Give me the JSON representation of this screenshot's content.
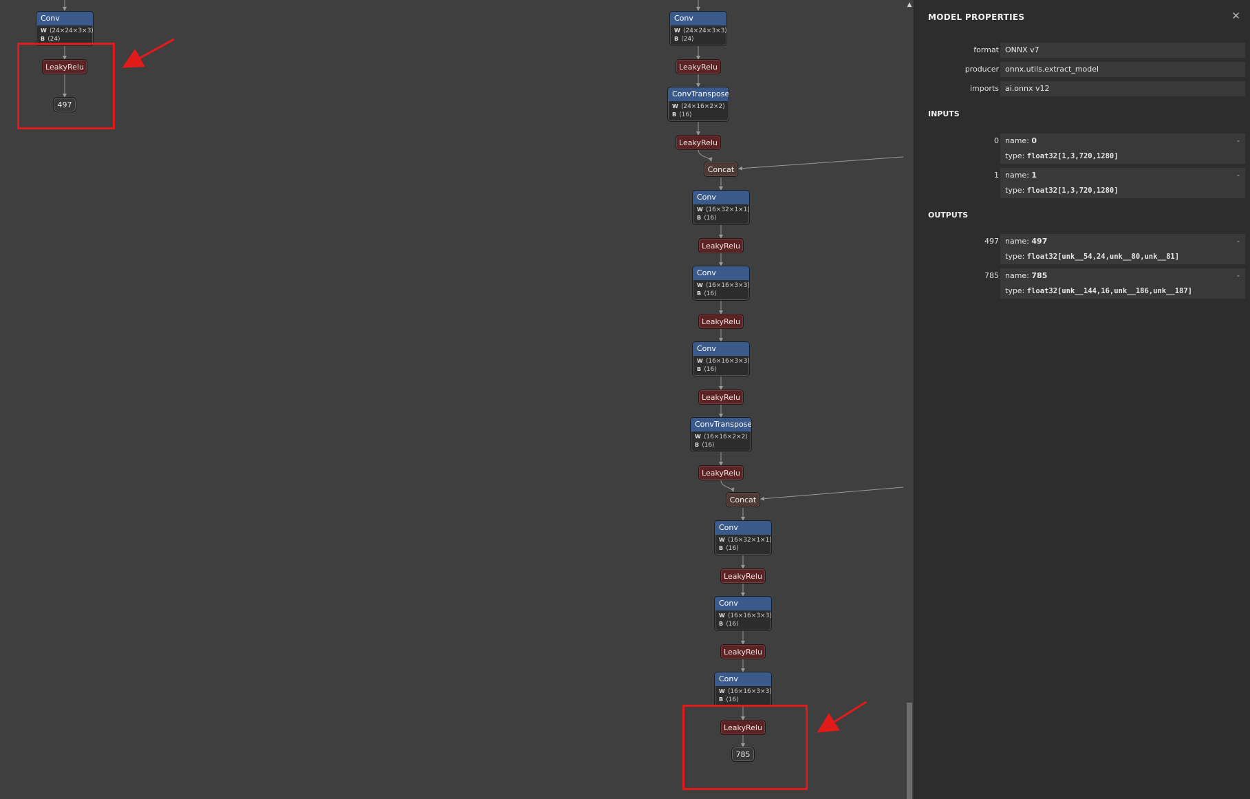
{
  "graph": {
    "nodes": {
      "l_conv": {
        "op": "Conv",
        "w": "⟨24×24×3×3⟩",
        "b": "⟨24⟩"
      },
      "l_relu": {
        "op": "LeakyRelu"
      },
      "l_out": {
        "label": "497"
      },
      "r_conv1": {
        "op": "Conv",
        "w": "⟨24×24×3×3⟩",
        "b": "⟨24⟩"
      },
      "r_relu1": {
        "op": "LeakyRelu"
      },
      "r_convt1": {
        "op": "ConvTranspose",
        "w": "⟨24×16×2×2⟩",
        "b": "⟨16⟩"
      },
      "r_relu2": {
        "op": "LeakyRelu"
      },
      "r_concat1": {
        "op": "Concat"
      },
      "r_conv2": {
        "op": "Conv",
        "w": "⟨16×32×1×1⟩",
        "b": "⟨16⟩"
      },
      "r_relu3": {
        "op": "LeakyRelu"
      },
      "r_conv3": {
        "op": "Conv",
        "w": "⟨16×16×3×3⟩",
        "b": "⟨16⟩"
      },
      "r_relu4": {
        "op": "LeakyRelu"
      },
      "r_conv4": {
        "op": "Conv",
        "w": "⟨16×16×3×3⟩",
        "b": "⟨16⟩"
      },
      "r_relu5": {
        "op": "LeakyRelu"
      },
      "r_convt2": {
        "op": "ConvTranspose",
        "w": "⟨16×16×2×2⟩",
        "b": "⟨16⟩"
      },
      "r_relu6": {
        "op": "LeakyRelu"
      },
      "r_concat2": {
        "op": "Concat"
      },
      "r_conv5": {
        "op": "Conv",
        "w": "⟨16×32×1×1⟩",
        "b": "⟨16⟩"
      },
      "r_relu7": {
        "op": "LeakyRelu"
      },
      "r_conv6": {
        "op": "Conv",
        "w": "⟨16×16×3×3⟩",
        "b": "⟨16⟩"
      },
      "r_relu8": {
        "op": "LeakyRelu"
      },
      "r_conv7": {
        "op": "Conv",
        "w": "⟨16×16×3×3⟩",
        "b": "⟨16⟩"
      },
      "r_relu9": {
        "op": "LeakyRelu"
      },
      "r_out": {
        "label": "785"
      }
    },
    "weight_label": "W",
    "bias_label": "B"
  },
  "sidebar": {
    "title": "MODEL PROPERTIES",
    "close_icon": "close-icon",
    "properties": [
      {
        "key": "format",
        "value": "ONNX v7"
      },
      {
        "key": "producer",
        "value": "onnx.utils.extract_model"
      },
      {
        "key": "imports",
        "value": "ai.onnx v12"
      }
    ],
    "inputs_title": "INPUTS",
    "inputs": [
      {
        "key": "0",
        "name_label": "name:",
        "name": "0",
        "type_label": "type:",
        "type": "float32[1,3,720,1280]",
        "dash": "-"
      },
      {
        "key": "1",
        "name_label": "name:",
        "name": "1",
        "type_label": "type:",
        "type": "float32[1,3,720,1280]",
        "dash": "-"
      }
    ],
    "outputs_title": "OUTPUTS",
    "outputs": [
      {
        "key": "497",
        "name_label": "name:",
        "name": "497",
        "type_label": "type:",
        "type": "float32[unk__54,24,unk__80,unk__81]",
        "dash": "-"
      },
      {
        "key": "785",
        "name_label": "name:",
        "name": "785",
        "type_label": "type:",
        "type": "float32[unk__144,16,unk__186,unk__187]",
        "dash": "-"
      }
    ]
  },
  "colors": {
    "conv_header": "#3a5a8c",
    "leakyrelu": "#5b2424",
    "concat": "#4d3a36",
    "highlight": "#e11a1a",
    "canvas": "#3f3f3f",
    "sidebar": "#2d2d2d"
  }
}
